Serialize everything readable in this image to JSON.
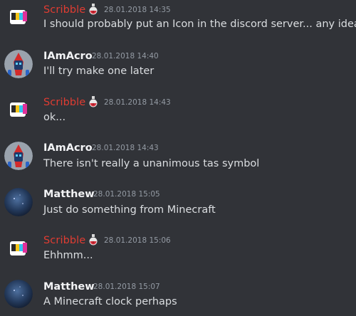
{
  "colors": {
    "background": "#313338",
    "scribble_name": "#e03c32",
    "member_name": "#f2f3f5",
    "timestamp": "#949ba4",
    "message_text": "#dbdee1"
  },
  "messages": [
    {
      "author": "Scribble",
      "author_color": "#e03c32",
      "role_icon": "potion-icon",
      "avatar": "scribble-avatar",
      "timestamp": "28.01.2018 14:35",
      "text": "I should probably put an Icon in the discord server... any ideas?"
    },
    {
      "author": "IAmAcro",
      "author_color": "#f2f3f5",
      "avatar": "iamacro-avatar",
      "timestamp": "28.01.2018 14:40",
      "text": "I'll try make one later"
    },
    {
      "author": "Scribble",
      "author_color": "#e03c32",
      "role_icon": "potion-icon",
      "avatar": "scribble-avatar",
      "timestamp": "28.01.2018 14:43",
      "text": "ok..."
    },
    {
      "author": "IAmAcro",
      "author_color": "#f2f3f5",
      "avatar": "iamacro-avatar",
      "timestamp": "28.01.2018 14:43",
      "text": "There isn't really a unanimous tas symbol"
    },
    {
      "author": "Matthew",
      "author_color": "#f2f3f5",
      "avatar": "matthew-avatar",
      "timestamp": "28.01.2018 15:05",
      "text": "Just do something from Minecraft"
    },
    {
      "author": "Scribble",
      "author_color": "#e03c32",
      "role_icon": "potion-icon",
      "avatar": "scribble-avatar",
      "timestamp": "28.01.2018 15:06",
      "text": "Ehhmm..."
    },
    {
      "author": "Matthew",
      "author_color": "#f2f3f5",
      "avatar": "matthew-avatar",
      "timestamp": "28.01.2018 15:07",
      "text": "A Minecraft clock perhaps"
    }
  ]
}
